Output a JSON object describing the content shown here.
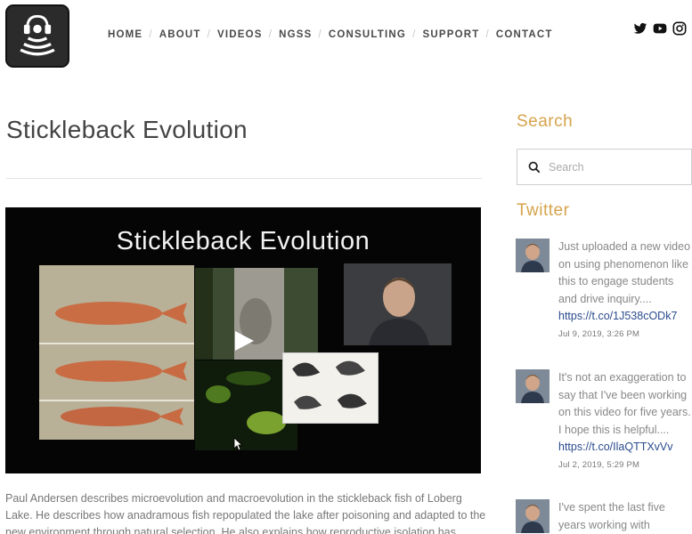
{
  "header": {
    "nav": [
      {
        "label": "HOME"
      },
      {
        "label": "ABOUT"
      },
      {
        "label": "VIDEOS"
      },
      {
        "label": "NGSS"
      },
      {
        "label": "CONSULTING"
      },
      {
        "label": "SUPPORT"
      },
      {
        "label": "CONTACT"
      }
    ],
    "social_icons": [
      "twitter-icon",
      "youtube-icon",
      "instagram-icon"
    ]
  },
  "post": {
    "title": "Stickleback Evolution",
    "video_title": "Stickleback Evolution",
    "description": "Paul Andersen describes microevolution and macroevolution in the stickleback fish of Loberg Lake. He describes how anadramous fish repopulated the lake after poisoning and adapted to the new environment through natural selection. He also explains how reproductive isolation has"
  },
  "sidebar": {
    "search_heading": "Search",
    "search_placeholder": "Search",
    "twitter_heading": "Twitter",
    "tweets": [
      {
        "text": "Just uploaded a new video on using phenomenon like this to engage students and drive inquiry....",
        "link": "https://t.co/1J538cODk7",
        "date": "Jul 9, 2019, 3:26 PM"
      },
      {
        "text": "It's not an exaggeration to say that I've been working on this video for five years. I hope this is helpful....",
        "link": "https://t.co/IlaQTTXvVv",
        "date": "Jul 2, 2019, 5:29 PM"
      },
      {
        "text": "I've spent the last five years working with",
        "link": "",
        "date": ""
      }
    ]
  },
  "colors": {
    "accent": "#d6a34c",
    "link": "#2a4b8d",
    "text_muted": "#888888"
  }
}
